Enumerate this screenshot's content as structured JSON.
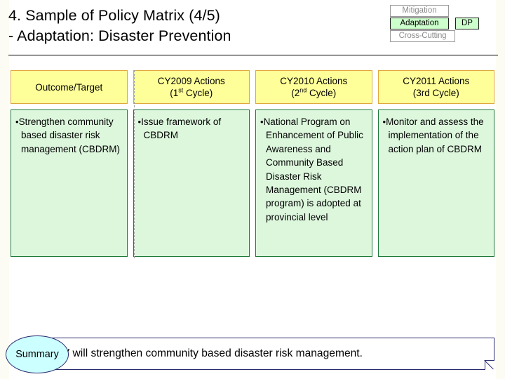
{
  "slide": {
    "title_line1": "4. Sample of Policy Matrix (4/5)",
    "title_line2": "- Adaptation: Disaster Prevention"
  },
  "tags": {
    "mitigation": "Mitigation",
    "adaptation": "Adaptation",
    "cross_cutting": "Cross-Cutting",
    "dp": "DP",
    "active": "Adaptation",
    "active_fill": "#ccffcc",
    "inactive_text": "#8d8d8d"
  },
  "matrix": {
    "header_fill": "#ffff99",
    "header_border": "#e0a83c",
    "body_fill": "#ddf7dd",
    "body_border": "#1f7a3a",
    "columns": [
      {
        "header_line1": "Outcome/Target",
        "header_line2": "",
        "header_ordinal": "",
        "header_line2_tail": "",
        "bullet": "•",
        "body": "Strengthen community based disaster risk management (CBDRM)"
      },
      {
        "header_line1": "CY2009 Actions",
        "header_line2": "(1",
        "header_ordinal": "st",
        "header_line2_tail": " Cycle)",
        "bullet": "•",
        "body": "Issue framework of CBDRM"
      },
      {
        "header_line1": "CY2010 Actions",
        "header_line2": "(2",
        "header_ordinal": "nd",
        "header_line2_tail": " Cycle)",
        "bullet": "•",
        "body": "National Program on Enhancement of Public Awareness and Community Based Disaster Risk Management (CBDRM program) is adopted at provincial level"
      },
      {
        "header_line1": "CY2011 Actions",
        "header_line2": "(3rd Cycle)",
        "header_ordinal": "",
        "header_line2_tail": "",
        "bullet": "•",
        "body": "Monitor and assess the implementation of the action plan of CBDRM"
      }
    ]
  },
  "summary": {
    "badge_label": "Summary",
    "text": "GoV will strengthen community based disaster risk management.",
    "badge_fill": "#ccffff",
    "border": "#272a6e"
  }
}
